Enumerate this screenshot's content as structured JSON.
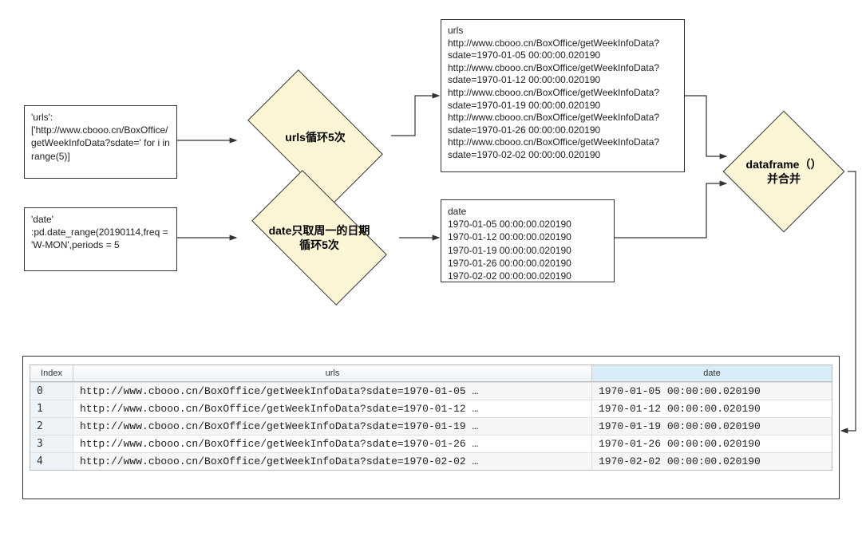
{
  "top_flow": {
    "urls_input": "'urls':\n['http://www.cbooo.cn/BoxOffice/getWeekInfoData?sdate=' for i in range(5)]",
    "date_input": "'date'\n:pd.date_range(20190114,freq = 'W-MON',periods = 5",
    "urls_diamond": "urls循环5次",
    "date_diamond": "date只取周一的日期\n循环5次",
    "urls_output_lines": [
      "urls",
      "http://www.cbooo.cn/BoxOffice/getWeekInfoData?sdate=1970-01-05 00:00:00.020190",
      "http://www.cbooo.cn/BoxOffice/getWeekInfoData?sdate=1970-01-12 00:00:00.020190",
      "http://www.cbooo.cn/BoxOffice/getWeekInfoData?sdate=1970-01-19 00:00:00.020190",
      "http://www.cbooo.cn/BoxOffice/getWeekInfoData?sdate=1970-01-26 00:00:00.020190",
      "http://www.cbooo.cn/BoxOffice/getWeekInfoData?sdate=1970-02-02 00:00:00.020190"
    ],
    "date_output_lines": [
      "date",
      "1970-01-05 00:00:00.020190",
      "1970-01-12 00:00:00.020190",
      "1970-01-19 00:00:00.020190",
      "1970-01-26 00:00:00.020190",
      "1970-02-02 00:00:00.020190"
    ],
    "merge_diamond": "dataframe（）\n并合并"
  },
  "table": {
    "headers": {
      "index": "Index",
      "urls": "urls",
      "date": "date"
    },
    "rows": [
      {
        "index": "0",
        "url": "http://www.cbooo.cn/BoxOffice/getWeekInfoData?sdate=1970-01-05 …",
        "date": "1970-01-05 00:00:00.020190"
      },
      {
        "index": "1",
        "url": "http://www.cbooo.cn/BoxOffice/getWeekInfoData?sdate=1970-01-12 …",
        "date": "1970-01-12 00:00:00.020190"
      },
      {
        "index": "2",
        "url": "http://www.cbooo.cn/BoxOffice/getWeekInfoData?sdate=1970-01-19 …",
        "date": "1970-01-19 00:00:00.020190"
      },
      {
        "index": "3",
        "url": "http://www.cbooo.cn/BoxOffice/getWeekInfoData?sdate=1970-01-26 …",
        "date": "1970-01-26 00:00:00.020190"
      },
      {
        "index": "4",
        "url": "http://www.cbooo.cn/BoxOffice/getWeekInfoData?sdate=1970-02-02 …",
        "date": "1970-02-02 00:00:00.020190"
      }
    ]
  }
}
